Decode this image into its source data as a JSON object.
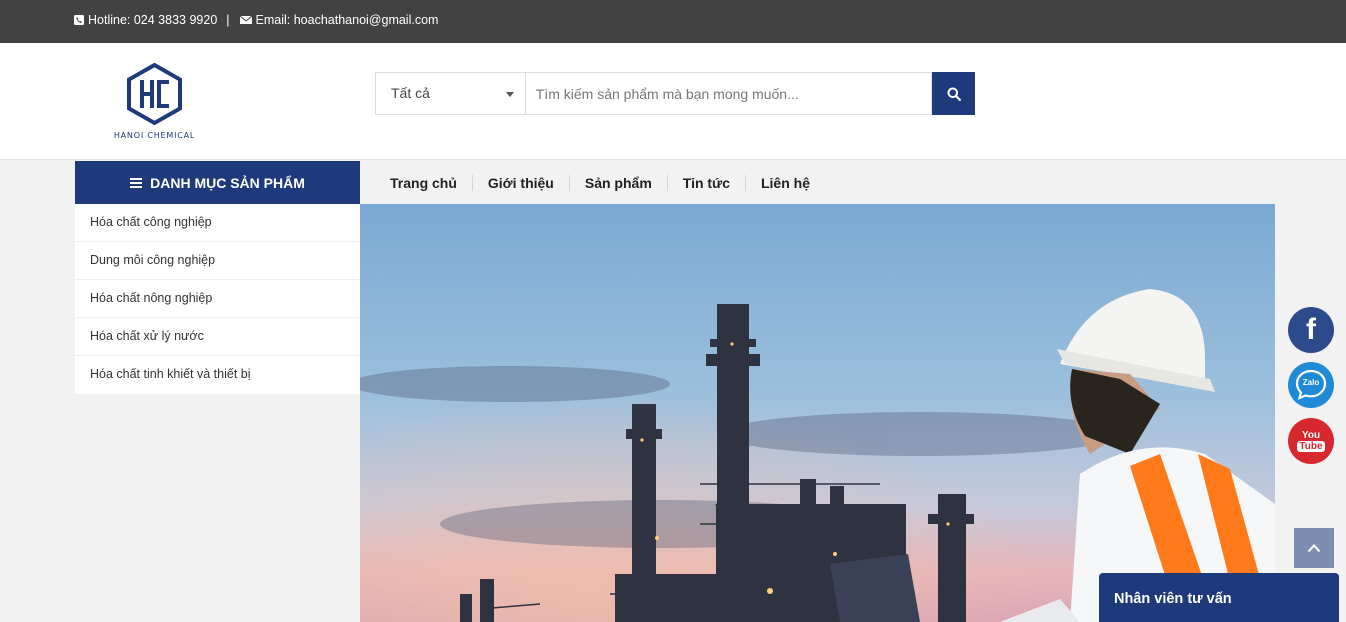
{
  "topbar": {
    "hotline": "Hotline: 024 3833 9920",
    "separator": "|",
    "email": "Email: hoachathanoi@gmail.com"
  },
  "logo": {
    "text": "HANOI CHEMICAL",
    "icon": "hexagon-hc-logo"
  },
  "search": {
    "category_selected": "Tất cả",
    "placeholder": "Tìm kiếm sản phẩm mà bạn mong muốn...",
    "button_icon": "search-icon"
  },
  "categories": {
    "title": "DANH MỤC SẢN PHẨM",
    "items": [
      "Hóa chất công nghiệp",
      "Dung môi công nghiệp",
      "Hóa chất nông nghiệp",
      "Hóa chất xử lý nước",
      "Hóa chất tinh khiết và thiết bị"
    ]
  },
  "nav": {
    "items": [
      "Trang chủ",
      "Giới thiệu",
      "Sản phẩm",
      "Tin tức",
      "Liên hệ"
    ]
  },
  "social": {
    "facebook": "f",
    "zalo": "Zalo",
    "youtube_1": "You",
    "youtube_2": "Tube"
  },
  "chat": {
    "label": "Nhân viên tư vấn"
  },
  "colors": {
    "brand": "#1e3a7b",
    "topbar": "#424242"
  }
}
